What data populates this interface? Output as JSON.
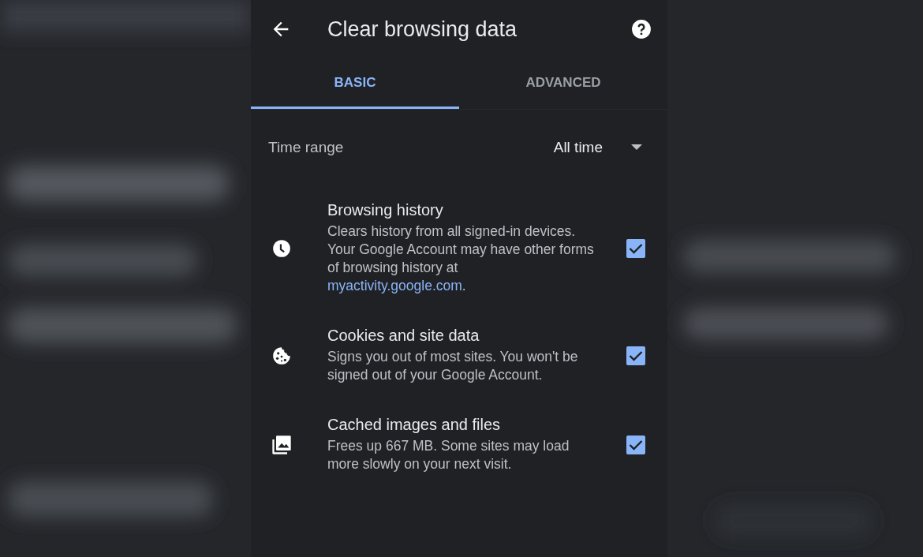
{
  "header": {
    "title": "Clear browsing data"
  },
  "tabs": [
    {
      "label": "BASIC",
      "selected": true
    },
    {
      "label": "ADVANCED",
      "selected": false
    }
  ],
  "time_range": {
    "label": "Time range",
    "value": "All time"
  },
  "items": [
    {
      "title": "Browsing history",
      "description": "Clears history from all signed-in devices. Your Google Account may have other forms of browsing history at ",
      "link": "myactivity.google.com",
      "description_end": ".",
      "checked": true
    },
    {
      "title": "Cookies and site data",
      "description": "Signs you out of most sites. You won't be signed out of your Google Account.",
      "checked": true
    },
    {
      "title": "Cached images and files",
      "description": "Frees up 667 MB. Some sites may load more slowly on your next visit.",
      "checked": true
    }
  ]
}
